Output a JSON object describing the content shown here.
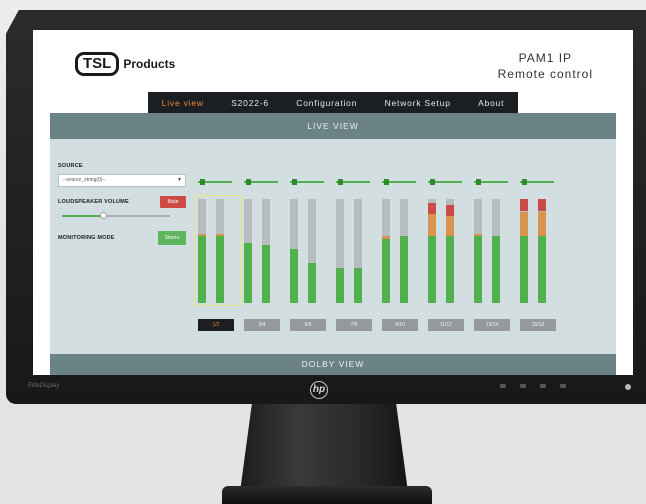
{
  "brand": {
    "logo_box": "TSL",
    "logo_text": "Products"
  },
  "header": {
    "line1": "PAM1 IP",
    "line2": "Remote control"
  },
  "nav": {
    "items": [
      {
        "label": "Live view",
        "active": true
      },
      {
        "label": "S2022-6",
        "active": false
      },
      {
        "label": "Configuration",
        "active": false
      },
      {
        "label": "Network Setup",
        "active": false
      },
      {
        "label": "About",
        "active": false
      }
    ]
  },
  "live_view": {
    "title": "LIVE VIEW"
  },
  "source": {
    "label": "SOURCE",
    "value": "--source_string(0)--"
  },
  "loudspeaker": {
    "label": "LOUDSPEAKER VOLUME",
    "mute_label": "Mute",
    "volume": 0.38
  },
  "monitoring": {
    "label": "MONITORING MODE",
    "mode_label": "Stereo"
  },
  "colors": {
    "accent": "#ef8a2f",
    "green": "#4fb04d",
    "amber": "#d8944f",
    "red": "#c94a47",
    "panel": "#d3dee0",
    "header": "#6b8386"
  },
  "channels": {
    "pairs": [
      {
        "label": "1/2",
        "selected": true,
        "fader": 0.05,
        "levels": [
          [
            0.64,
            0.02,
            0
          ],
          [
            0.64,
            0.02,
            0
          ]
        ]
      },
      {
        "label": "3/4",
        "selected": false,
        "fader": 0.05,
        "levels": [
          [
            0.58,
            0,
            0
          ],
          [
            0.56,
            0,
            0
          ]
        ]
      },
      {
        "label": "5/6",
        "selected": false,
        "fader": 0.05,
        "levels": [
          [
            0.52,
            0,
            0
          ],
          [
            0.38,
            0,
            0
          ]
        ]
      },
      {
        "label": "7/8",
        "selected": false,
        "fader": 0.05,
        "levels": [
          [
            0.34,
            0,
            0
          ],
          [
            0.34,
            0,
            0
          ]
        ]
      },
      {
        "label": "9/10",
        "selected": false,
        "fader": 0.05,
        "levels": [
          [
            0.62,
            0.02,
            0
          ],
          [
            0.64,
            0,
            0
          ]
        ]
      },
      {
        "label": "11/12",
        "selected": false,
        "fader": 0.05,
        "levels": [
          [
            0.64,
            0.22,
            0.1
          ],
          [
            0.64,
            0.2,
            0.1
          ]
        ]
      },
      {
        "label": "13/14",
        "selected": false,
        "fader": 0.05,
        "levels": [
          [
            0.64,
            0.02,
            0
          ],
          [
            0.64,
            0,
            0
          ]
        ]
      },
      {
        "label": "15/16",
        "selected": false,
        "fader": 0.05,
        "levels": [
          [
            0.64,
            0.24,
            0.12
          ],
          [
            0.64,
            0.24,
            0.12
          ]
        ]
      }
    ]
  },
  "dolby": {
    "title": "DOLBY VIEW"
  },
  "monitor": {
    "chin_brand": "EliteDisplay"
  }
}
